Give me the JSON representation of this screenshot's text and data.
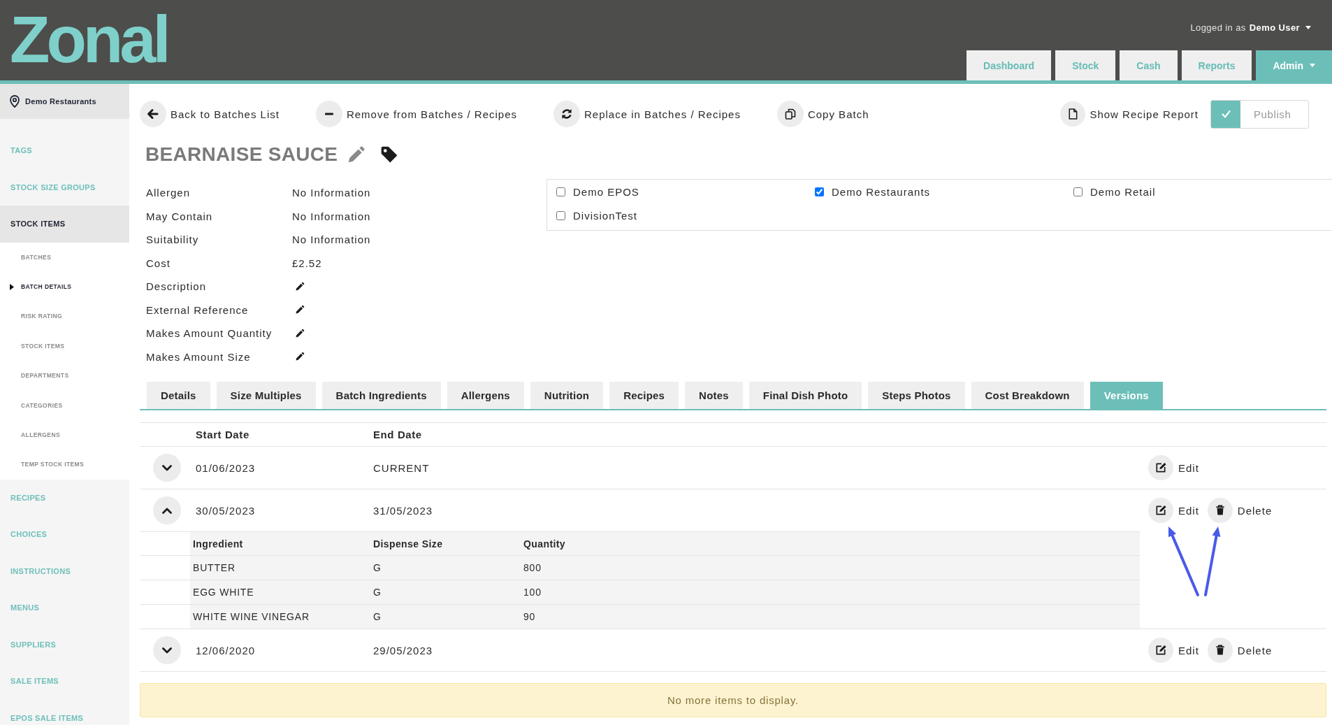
{
  "header": {
    "logo": "Zonal",
    "user": {
      "prefix": "Logged in as",
      "name": "Demo User"
    },
    "nav": [
      {
        "label": "Dashboard",
        "selected": false,
        "dropdown": false
      },
      {
        "label": "Stock",
        "selected": false,
        "dropdown": false
      },
      {
        "label": "Cash",
        "selected": false,
        "dropdown": false
      },
      {
        "label": "Reports",
        "selected": false,
        "dropdown": false
      },
      {
        "label": "Admin",
        "selected": true,
        "dropdown": true
      }
    ]
  },
  "sidebar": {
    "location": "Demo Restaurants",
    "items": [
      {
        "label": "TAGS",
        "selected": false
      },
      {
        "label": "STOCK SIZE GROUPS",
        "selected": false
      },
      {
        "label": "STOCK ITEMS",
        "selected": true,
        "children": [
          {
            "label": "BATCHES",
            "selected": false
          },
          {
            "label": "BATCH DETAILS",
            "selected": true
          },
          {
            "label": "RISK RATING",
            "selected": false
          },
          {
            "label": "STOCK ITEMS",
            "selected": false
          },
          {
            "label": "DEPARTMENTS",
            "selected": false
          },
          {
            "label": "CATEGORIES",
            "selected": false
          },
          {
            "label": "ALLERGENS",
            "selected": false
          },
          {
            "label": "TEMP STOCK ITEMS",
            "selected": false
          }
        ]
      },
      {
        "label": "RECIPES",
        "selected": false
      },
      {
        "label": "CHOICES",
        "selected": false
      },
      {
        "label": "INSTRUCTIONS",
        "selected": false
      },
      {
        "label": "MENUS",
        "selected": false
      },
      {
        "label": "SUPPLIERS",
        "selected": false
      },
      {
        "label": "SALE ITEMS",
        "selected": false
      },
      {
        "label": "EPOS SALE ITEMS",
        "selected": false
      }
    ]
  },
  "toolbar": {
    "actions": [
      {
        "label": "Back to Batches List",
        "kind": "back"
      },
      {
        "label": "Remove from Batches / Recipes",
        "kind": "remove"
      },
      {
        "label": "Replace in Batches / Recipes",
        "kind": "replace"
      },
      {
        "label": "Copy Batch",
        "kind": "copy"
      }
    ],
    "report": {
      "label": "Show Recipe Report"
    },
    "publish": {
      "label": "Publish",
      "on": true
    }
  },
  "batch": {
    "title": "BEARNAISE SAUCE",
    "details": [
      {
        "label": "Allergen",
        "kind": "text",
        "value": "No Information"
      },
      {
        "label": "May Contain",
        "kind": "text",
        "value": "No Information"
      },
      {
        "label": "Suitability",
        "kind": "text",
        "value": "No Information"
      },
      {
        "label": "Cost",
        "kind": "text",
        "value": "£2.52"
      },
      {
        "label": "Description",
        "kind": "edit"
      },
      {
        "label": "External Reference",
        "kind": "edit"
      },
      {
        "label": "Makes Amount Quantity",
        "kind": "edit"
      },
      {
        "label": "Makes Amount Size",
        "kind": "edit"
      }
    ]
  },
  "divisions": [
    {
      "label": "Demo EPOS",
      "checked": false
    },
    {
      "label": "Demo Restaurants",
      "checked": true
    },
    {
      "label": "Demo Retail",
      "checked": false
    },
    {
      "label": "DivisionTest",
      "checked": false
    }
  ],
  "tabs": [
    {
      "label": "Details",
      "selected": false
    },
    {
      "label": "Size Multiples",
      "selected": false
    },
    {
      "label": "Batch Ingredients",
      "selected": false
    },
    {
      "label": "Allergens",
      "selected": false
    },
    {
      "label": "Nutrition",
      "selected": false
    },
    {
      "label": "Recipes",
      "selected": false
    },
    {
      "label": "Notes",
      "selected": false
    },
    {
      "label": "Final Dish Photo",
      "selected": false
    },
    {
      "label": "Steps Photos",
      "selected": false
    },
    {
      "label": "Cost Breakdown",
      "selected": false
    },
    {
      "label": "Versions",
      "selected": true
    }
  ],
  "versions": {
    "columns": [
      "Start Date",
      "End Date"
    ],
    "rows": [
      {
        "start": "01/06/2023",
        "end": "CURRENT",
        "expanded": false,
        "actions": [
          {
            "label": "Edit",
            "kind": "edit"
          }
        ]
      },
      {
        "start": "30/05/2023",
        "end": "31/05/2023",
        "expanded": true,
        "actions": [
          {
            "label": "Edit",
            "kind": "edit"
          },
          {
            "label": "Delete",
            "kind": "delete"
          }
        ],
        "ingredients": {
          "columns": [
            "Ingredient",
            "Dispense Size",
            "Quantity"
          ],
          "rows": [
            [
              "BUTTER",
              "G",
              "800"
            ],
            [
              "EGG WHITE",
              "G",
              "100"
            ],
            [
              "WHITE WINE VINEGAR",
              "G",
              "90"
            ]
          ]
        }
      },
      {
        "start": "12/06/2020",
        "end": "29/05/2023",
        "expanded": false,
        "actions": [
          {
            "label": "Edit",
            "kind": "edit"
          },
          {
            "label": "Delete",
            "kind": "delete"
          }
        ]
      }
    ],
    "empty_message": "No more items to display."
  }
}
